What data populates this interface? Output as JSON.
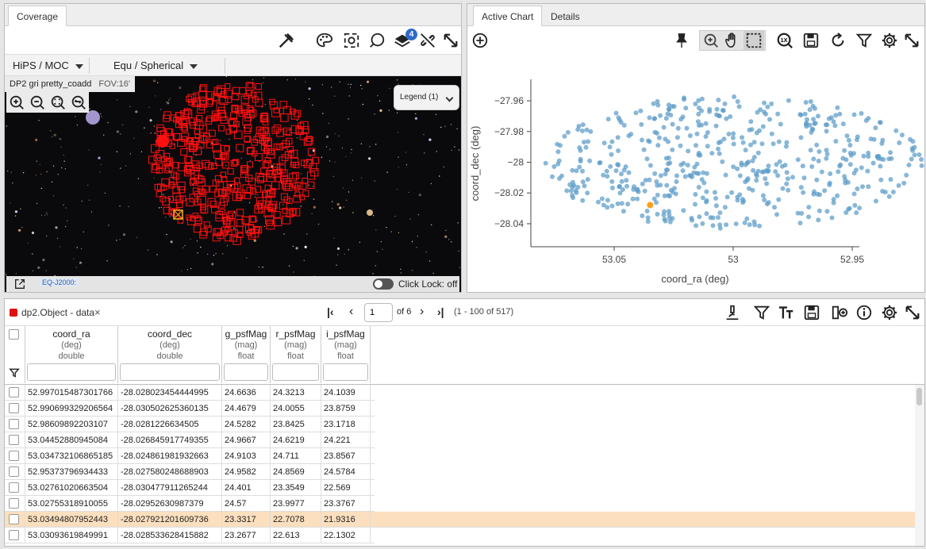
{
  "left_panel": {
    "tab": "Coverage",
    "selector_hips": "HiPS / MOC",
    "selector_coords": "Equ / Spherical",
    "image_title": "DP2 gri pretty_coadd",
    "fov": "FOV:16'",
    "legend_label": "Legend (1)",
    "layers_badge": "4",
    "coord_system": "EQ-J2000:",
    "click_lock": "Click Lock: off"
  },
  "right_panel": {
    "tabs": [
      "Active Chart",
      "Details"
    ]
  },
  "chart_data": {
    "type": "scatter",
    "xlabel": "coord_ra (deg)",
    "ylabel": "coord_dec (deg)",
    "x_ticks": [
      "53.05",
      "53",
      "52.95"
    ],
    "y_ticks": [
      "-27.96",
      "-27.98",
      "-28",
      "-28.02",
      "-28.04"
    ],
    "xlim": [
      53.085,
      52.947
    ],
    "ylim": [
      -28.055,
      -27.946
    ],
    "point_color": "#5b9bc8",
    "highlight_color": "#ff9f1c",
    "highlight_point": {
      "x": 53.0349,
      "y": -28.0279
    },
    "n_points": 517
  },
  "table": {
    "title": "dp2.Object - data",
    "page_input": "1",
    "page_of": "of 6",
    "range": "(1 - 100 of 517)",
    "columns": [
      {
        "name": "coord_ra",
        "unit": "(deg)",
        "type": "double"
      },
      {
        "name": "coord_dec",
        "unit": "(deg)",
        "type": "double"
      },
      {
        "name": "g_psfMag",
        "unit": "(mag)",
        "type": "float"
      },
      {
        "name": "r_psfMag",
        "unit": "(mag)",
        "type": "float"
      },
      {
        "name": "i_psfMag",
        "unit": "(mag)",
        "type": "float"
      }
    ],
    "rows": [
      [
        "52.997015487301766",
        "-28.028023454444995",
        "24.6636",
        "24.3213",
        "24.1039"
      ],
      [
        "52.990699329206564",
        "-28.030502625360135",
        "24.4679",
        "24.0055",
        "23.8759"
      ],
      [
        "52.98609892203107",
        "-28.0281226634505",
        "24.5282",
        "23.8425",
        "23.1718"
      ],
      [
        "53.04452880945084",
        "-28.026845917749355",
        "24.9667",
        "24.6219",
        "24.221"
      ],
      [
        "53.034732106865185",
        "-28.024861981932663",
        "24.9103",
        "24.711",
        "23.8567"
      ],
      [
        "52.95373796934433",
        "-28.027580248688903",
        "24.9582",
        "24.8569",
        "24.5784"
      ],
      [
        "53.02761020663504",
        "-28.030477911265244",
        "24.401",
        "23.3549",
        "22.569"
      ],
      [
        "53.02755318910055",
        "-28.02952630987379",
        "24.57",
        "23.9977",
        "23.3767"
      ],
      [
        "53.03494807952443",
        "-28.027921201609736",
        "23.3317",
        "22.7078",
        "21.9316"
      ],
      [
        "53.03093619849991",
        "-28.028533628415882",
        "23.2677",
        "22.613",
        "22.1302"
      ]
    ],
    "highlight_row": 8
  }
}
